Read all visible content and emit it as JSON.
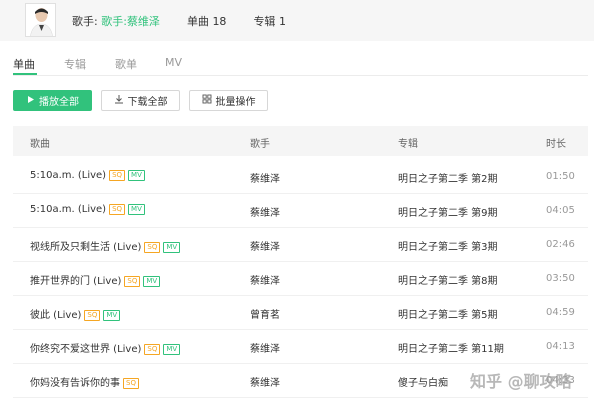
{
  "header": {
    "singer_prefix": "歌手:",
    "singer_label": "歌手:",
    "singer_name": "蔡维泽",
    "singles_label": "单曲",
    "singles_count": "18",
    "albums_label": "专辑",
    "albums_count": "1"
  },
  "tabs": [
    {
      "label": "单曲",
      "active": true
    },
    {
      "label": "专辑",
      "active": false
    },
    {
      "label": "歌单",
      "active": false
    },
    {
      "label": "MV",
      "active": false
    }
  ],
  "toolbar": {
    "play_all": "播放全部",
    "download_all": "下载全部",
    "batch_ops": "批量操作"
  },
  "table": {
    "columns": [
      "歌曲",
      "歌手",
      "专辑",
      "时长"
    ],
    "rows": [
      {
        "title": "5:10a.m. (Live)",
        "sq": "SQ",
        "mv": "MV",
        "artist": "蔡维泽",
        "album": "明日之子第二季 第2期",
        "duration": "01:50"
      },
      {
        "title": "5:10a.m. (Live)",
        "sq": "SQ",
        "mv": "MV",
        "artist": "蔡维泽",
        "album": "明日之子第二季 第9期",
        "duration": "04:05"
      },
      {
        "title": "视线所及只剩生活 (Live)",
        "sq": "SQ",
        "mv": "MV",
        "artist": "蔡维泽",
        "album": "明日之子第二季 第3期",
        "duration": "02:46"
      },
      {
        "title": "推开世界的门 (Live)",
        "sq": "SQ",
        "mv": "MV",
        "artist": "蔡维泽",
        "album": "明日之子第二季 第8期",
        "duration": "03:50"
      },
      {
        "title": "彼此 (Live)",
        "sq": "SQ",
        "mv": "MV",
        "artist": "曾育茗",
        "album": "明日之子第二季 第5期",
        "duration": "04:59"
      },
      {
        "title": "你终究不爱这世界 (Live)",
        "sq": "SQ",
        "mv": "MV",
        "artist": "蔡维泽",
        "album": "明日之子第二季 第11期",
        "duration": "04:13"
      },
      {
        "title": "你妈没有告诉你的事",
        "sq": "SQ",
        "mv": "",
        "artist": "蔡维泽",
        "album": "傻子与白痴",
        "duration": "04:33"
      }
    ]
  },
  "watermark": "知乎 @聊攻略",
  "colors": {
    "accent": "#31c27c",
    "sq_tag": "#f5a623",
    "header_bg": "#f6f6f6"
  },
  "icons": {
    "play": "play-icon",
    "download": "download-icon",
    "batch": "grid-icon"
  }
}
